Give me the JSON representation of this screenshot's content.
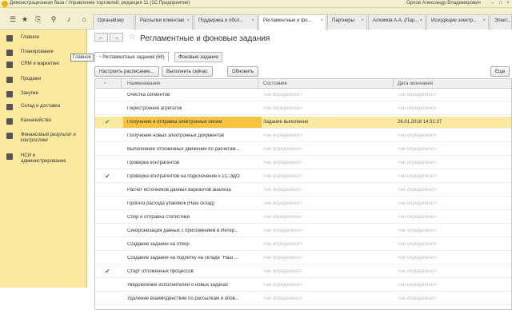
{
  "window": {
    "title": "Демонстрационная база / Управление торговлей, редакция 11  (1С:Предприятие)",
    "user": "Орлов Александр Владимирович"
  },
  "tabs": [
    {
      "label": "Органайзер"
    },
    {
      "label": "Рассылки клиентам"
    },
    {
      "label": "Поддержка и обсл..."
    },
    {
      "label": "Регламентные и фо..."
    },
    {
      "label": "Партнеры"
    },
    {
      "label": "Алхимов А.А. (Пар..."
    },
    {
      "label": "Исходящие электр..."
    },
    {
      "label": "Элект..."
    }
  ],
  "sidebar": {
    "tooltip": "Главное",
    "items": [
      {
        "label": "Главное"
      },
      {
        "label": "Планирование"
      },
      {
        "label": "CRM и маркетинг"
      },
      {
        "label": "Продажи"
      },
      {
        "label": "Закупки"
      },
      {
        "label": "Склад и доставка"
      },
      {
        "label": "Казначейство"
      },
      {
        "label": "Финансовый результат и контроллинг"
      },
      {
        "label": "НСИ и администрирование"
      }
    ]
  },
  "page": {
    "title": "Регламентные и фоновые задания",
    "content_tabs": [
      {
        "label": "Регламентные задания (68)"
      },
      {
        "label": "Фоновые задания"
      }
    ],
    "buttons": {
      "schedule": "Настроить расписание...",
      "run": "Выполнить сейчас",
      "refresh": "Обновить",
      "more": "Еще"
    }
  },
  "table": {
    "columns": {
      "name": "Наименование",
      "state": "Состояние",
      "end": "Дата окончания"
    },
    "rows": [
      {
        "check": false,
        "name": "Очистка сегментов",
        "state": "<не определено>",
        "end": "<не определено>"
      },
      {
        "check": false,
        "name": "Перестроение агрегатов",
        "state": "<не определено>",
        "end": "<не определено>"
      },
      {
        "check": true,
        "name": "Получение и отправка электронных писем",
        "state": "Задание выполнено",
        "end": "26.01.2018 14:31:37"
      },
      {
        "check": false,
        "name": "Получение новых электронных документов",
        "state": "<не определено>",
        "end": "<не определено>"
      },
      {
        "check": false,
        "name": "Выполнение отложенных движений по расчетам...",
        "state": "<не определено>",
        "end": "<не определено>"
      },
      {
        "check": false,
        "name": "Проверка контрагентов",
        "state": "<не определено>",
        "end": "<не определено>"
      },
      {
        "check": true,
        "name": "Проверка контрагентов на подключение к 1С-ЭДО",
        "state": "<не определено>",
        "end": "<не определено>"
      },
      {
        "check": false,
        "name": "Расчет источников данных вариантов анализа",
        "state": "<не определено>",
        "end": "<не определено>"
      },
      {
        "check": false,
        "name": "Прогноз расхода упаковок (Наш склад)",
        "state": "<не определено>",
        "end": "<не определено>"
      },
      {
        "check": false,
        "name": "Сбор и отправка статистики",
        "state": "<не определено>",
        "end": "<не определено>"
      },
      {
        "check": false,
        "name": "Синхронизация данных с приложением в Интер...",
        "state": "<не определено>",
        "end": "<не определено>"
      },
      {
        "check": false,
        "name": "Создание заданий на отбор",
        "state": "<не определено>",
        "end": "<не определено>"
      },
      {
        "check": false,
        "name": "Создание заданий на подпитку на складе \"Наш ...",
        "state": "<не определено>",
        "end": "<не определено>"
      },
      {
        "check": true,
        "name": "Старт отложенных процессов",
        "state": "<не определено>",
        "end": "<не определено>"
      },
      {
        "check": false,
        "name": "Уведомление исполнителей о новых задачах",
        "state": "<не определено>",
        "end": "<не определено>"
      },
      {
        "check": false,
        "name": "Удаление взаимодействий по рассылкам и опов...",
        "state": "<не определено>",
        "end": "<не определено>"
      }
    ]
  }
}
